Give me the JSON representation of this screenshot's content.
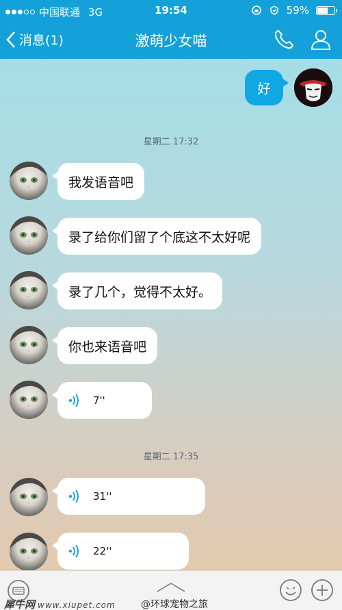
{
  "status_bar": {
    "carrier": "中国联通",
    "network": "3G",
    "time": "19:54",
    "battery": "59%",
    "battery_level": 0.59
  },
  "nav": {
    "back_label": "消息(1)",
    "title": "激萌少女喵",
    "phone_icon": "phone-icon",
    "profile_icon": "profile-icon"
  },
  "colors": {
    "bar_blue": "#14a1d9",
    "self_bubble": "#10a7e3",
    "voice_wave": "#1ca3e0"
  },
  "messages": [
    {
      "type": "text",
      "sender": "self",
      "text": "好"
    },
    {
      "type": "timestamp",
      "text": "星期二 17:32"
    },
    {
      "type": "text",
      "sender": "other",
      "text": "我发语音吧"
    },
    {
      "type": "text",
      "sender": "other",
      "text": "录了给你们留了个底这不太好呢"
    },
    {
      "type": "text",
      "sender": "other",
      "text": "录了几个，觉得不太好。"
    },
    {
      "type": "text",
      "sender": "other",
      "text": "你也来语音吧"
    },
    {
      "type": "voice",
      "sender": "other",
      "duration": "7''"
    },
    {
      "type": "timestamp",
      "text": "星期二 17:35"
    },
    {
      "type": "voice",
      "sender": "other",
      "duration": "31''"
    },
    {
      "type": "voice",
      "sender": "other",
      "duration": "22''"
    }
  ],
  "toolbar": {
    "keyboard_icon": "keyboard-icon",
    "expand_icon": "chevron-up-icon",
    "emoji_icon": "emoji-icon",
    "plus_icon": "plus-icon"
  },
  "watermark": {
    "left": "犀牛网",
    "left_url": "www.xiupet.com",
    "right": "@环球宠物之旅"
  }
}
